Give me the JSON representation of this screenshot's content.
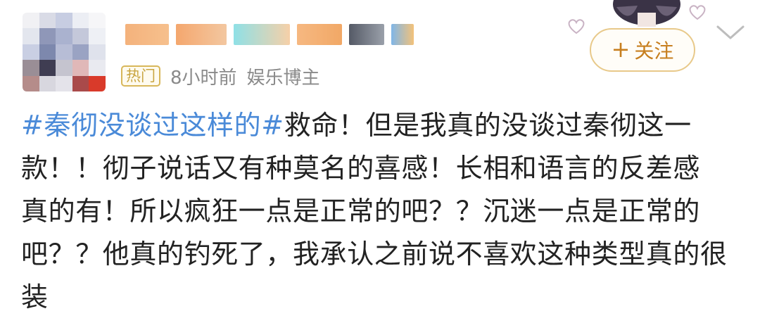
{
  "header": {
    "hot_badge": "热门",
    "timestamp": "8小时前",
    "category": "娱乐博主",
    "follow": {
      "plus_icon": "+",
      "label": "关注"
    }
  },
  "post": {
    "hashtag": "#秦彻没谈过这样的#",
    "line1_rest": "救命！但是我真的没谈过秦彻这一",
    "line2": "款！！彻子说话又有种莫名的喜感！长相和语言的反差感",
    "line3": "真的有！所以疯狂一点是正常的吧？？沉迷一点是正常的",
    "line4": "吧？？他真的钓死了，我承认之前说不喜欢这种类型真的很",
    "line5": "装"
  },
  "icons": {
    "avatar": "blurred-avatar",
    "heart_left": "heart-outline-icon",
    "heart_right": "heart-outline-icon",
    "chevron": "chevron-down-icon"
  },
  "colors": {
    "hashtag": "#4a8ad8",
    "follow_text": "#c77f1f",
    "follow_border": "#e8c98a",
    "hot_badge": "#c9a642",
    "meta": "#8a8a8a"
  }
}
